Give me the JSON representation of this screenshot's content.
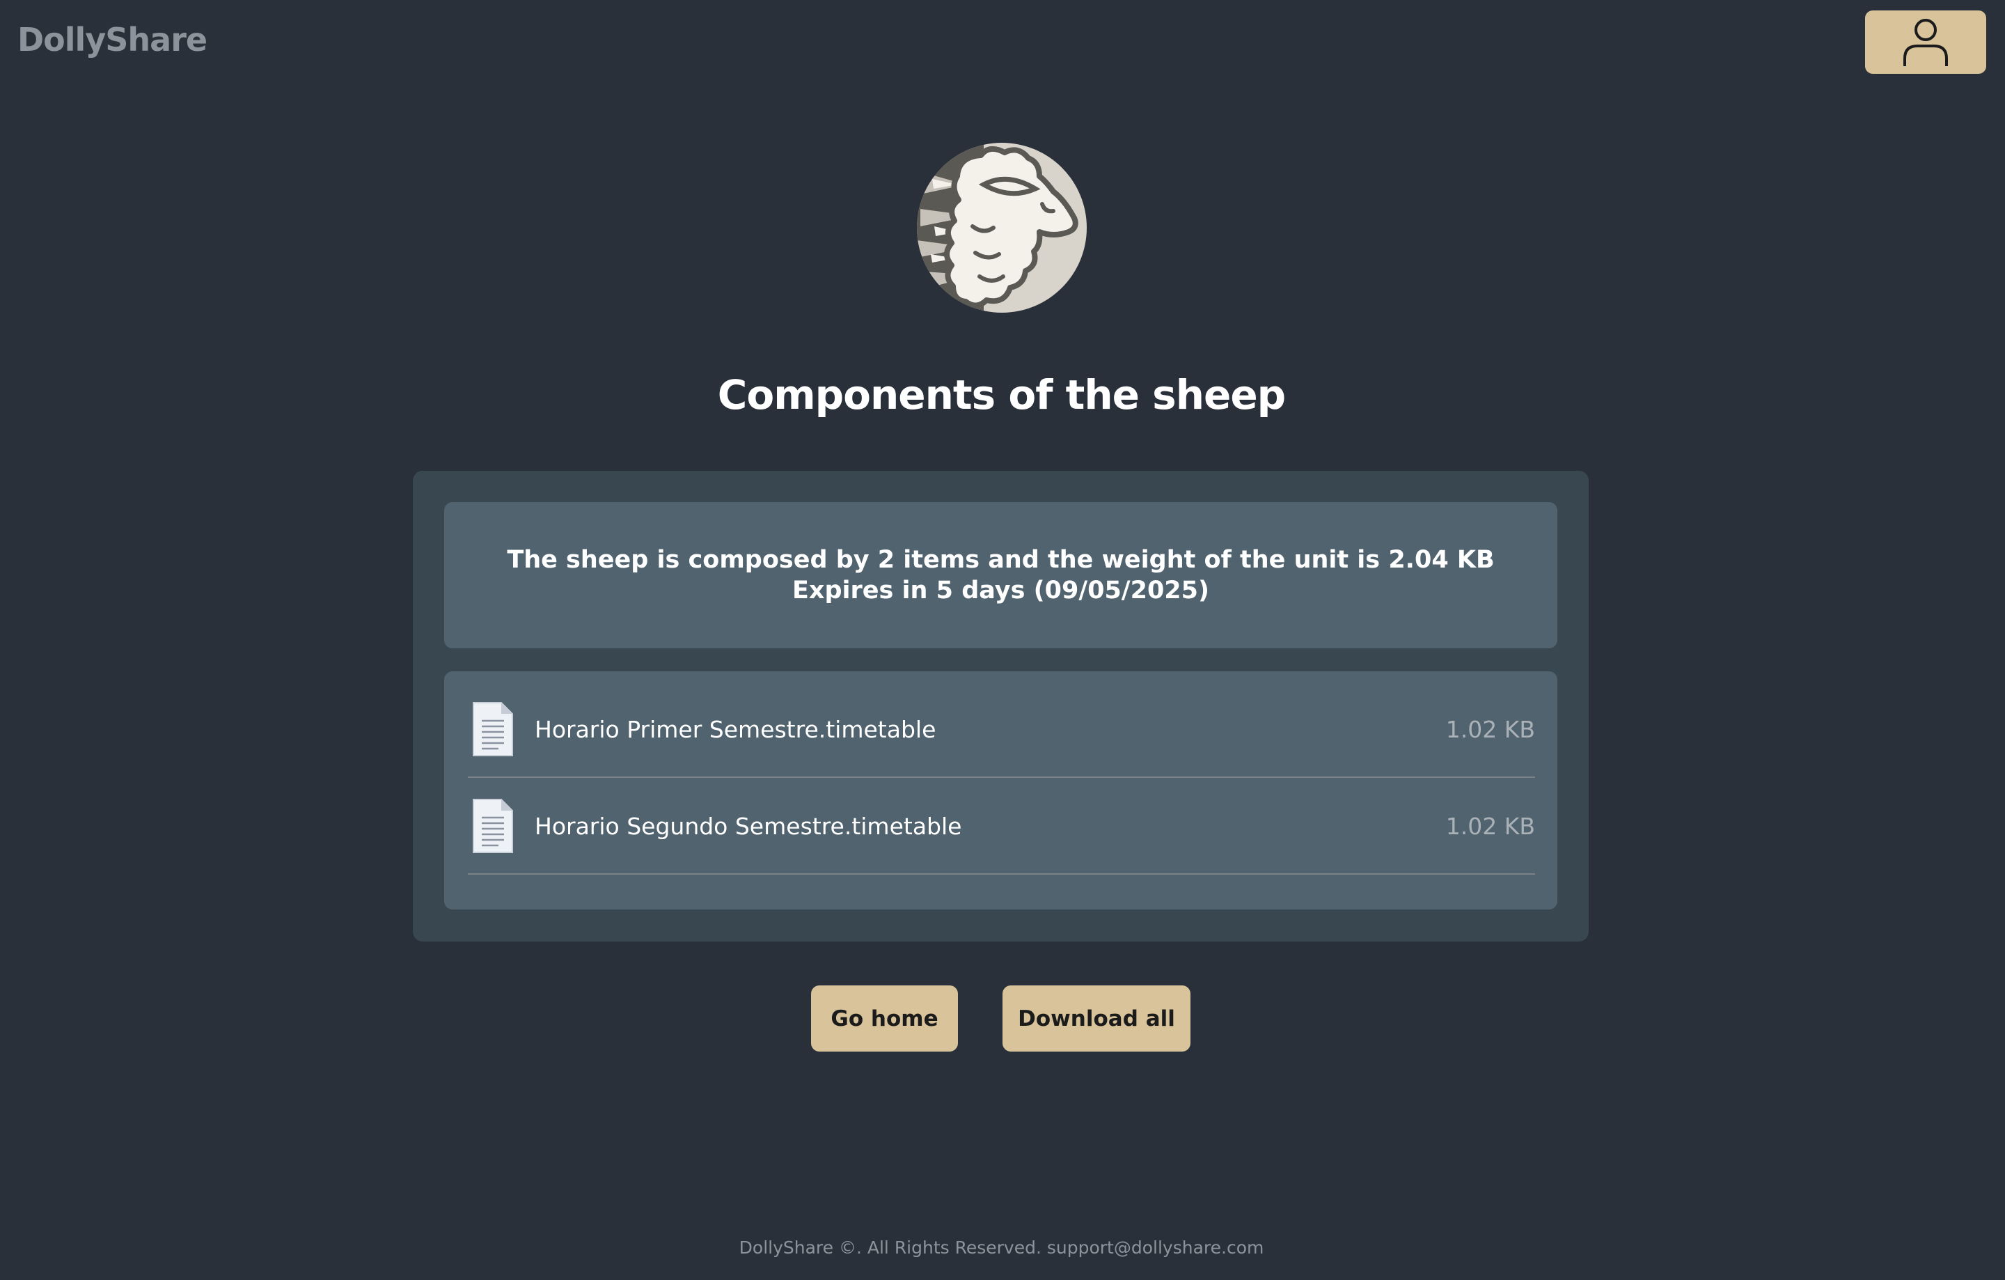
{
  "app": {
    "brand": "DollyShare"
  },
  "header": {
    "user_icon": "user-icon"
  },
  "page": {
    "title": "Components of the sheep",
    "logo_icon": "sheep-logo"
  },
  "summary": {
    "line1": "The sheep is composed by 2 items and the weight of the unit is 2.04 KB",
    "line2": "Expires in 5 days (09/05/2025)"
  },
  "files": [
    {
      "name": "Horario Primer Semestre.timetable",
      "size": "1.02 KB",
      "icon": "document-icon"
    },
    {
      "name": "Horario Segundo Semestre.timetable",
      "size": "1.02 KB",
      "icon": "document-icon"
    }
  ],
  "actions": {
    "home_label": "Go home",
    "download_label": "Download all"
  },
  "footer": {
    "text": "DollyShare ©. All Rights Reserved. support@dollyshare.com"
  },
  "colors": {
    "background": "#29303a",
    "panel": "#394751",
    "card": "#51636f",
    "accent": "#d8c39a"
  }
}
